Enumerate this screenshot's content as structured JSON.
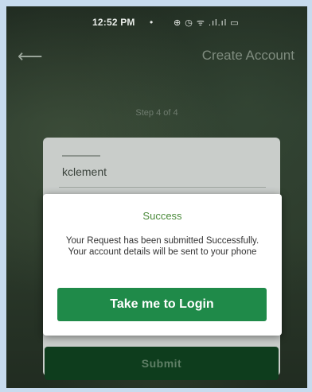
{
  "status_bar": {
    "time": "12:52 PM",
    "dot": "•",
    "icons": [
      "alarm-icon",
      "clock-icon",
      "wifi-icon",
      "signal-icon",
      "battery-icon"
    ],
    "icons_text": "⊕ ◷ ᯤ .ıl.ıl ▭"
  },
  "header": {
    "back_icon": "back-arrow-icon",
    "back_glyph": "⟵",
    "title": "Create Account"
  },
  "form": {
    "step_text": "Step 4 of 4",
    "field_value": "kclement",
    "submit_label": "Submit"
  },
  "dialog": {
    "title": "Success",
    "message": "Your Request has been submitted Successfully. Your account details will be sent to your phone",
    "button_label": "Take me to Login"
  },
  "colors": {
    "accent_green": "#1f8a49",
    "success_text": "#4a8a3a",
    "submit_dark": "#0e3d1d"
  }
}
